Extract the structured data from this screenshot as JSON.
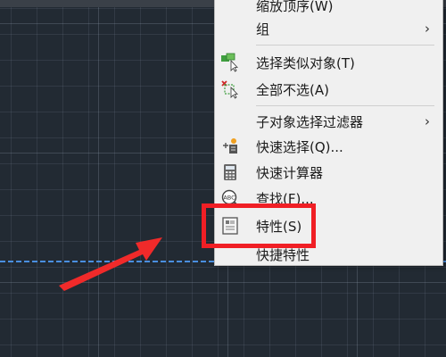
{
  "menu": {
    "items": [
      {
        "label": "缩放顶序(W)",
        "has_submenu": false,
        "icon": "none"
      },
      {
        "label": "组",
        "has_submenu": true,
        "icon": "none"
      },
      {
        "label": "选择类似对象(T)",
        "has_submenu": false,
        "icon": "select-similar-icon"
      },
      {
        "label": "全部不选(A)",
        "has_submenu": false,
        "icon": "deselect-all-icon"
      },
      {
        "label": "子对象选择过滤器",
        "has_submenu": true,
        "icon": "none"
      },
      {
        "label": "快速选择(Q)...",
        "has_submenu": false,
        "icon": "quick-select-icon"
      },
      {
        "label": "快速计算器",
        "has_submenu": false,
        "icon": "calculator-icon"
      },
      {
        "label": "查找(F)...",
        "has_submenu": false,
        "icon": "find-text-icon"
      },
      {
        "label": "特性(S)",
        "has_submenu": false,
        "icon": "properties-icon"
      },
      {
        "label": "快捷特性",
        "has_submenu": false,
        "icon": "none"
      }
    ],
    "submenu_chevron": "›",
    "highlighted_item": "特性(S)"
  },
  "colors": {
    "canvas_background": "#222a33",
    "menu_background": "#f0f0f0",
    "highlight_border": "#f01f25",
    "arrow": "#f02a2a",
    "selection_line": "#4a8fe0"
  }
}
